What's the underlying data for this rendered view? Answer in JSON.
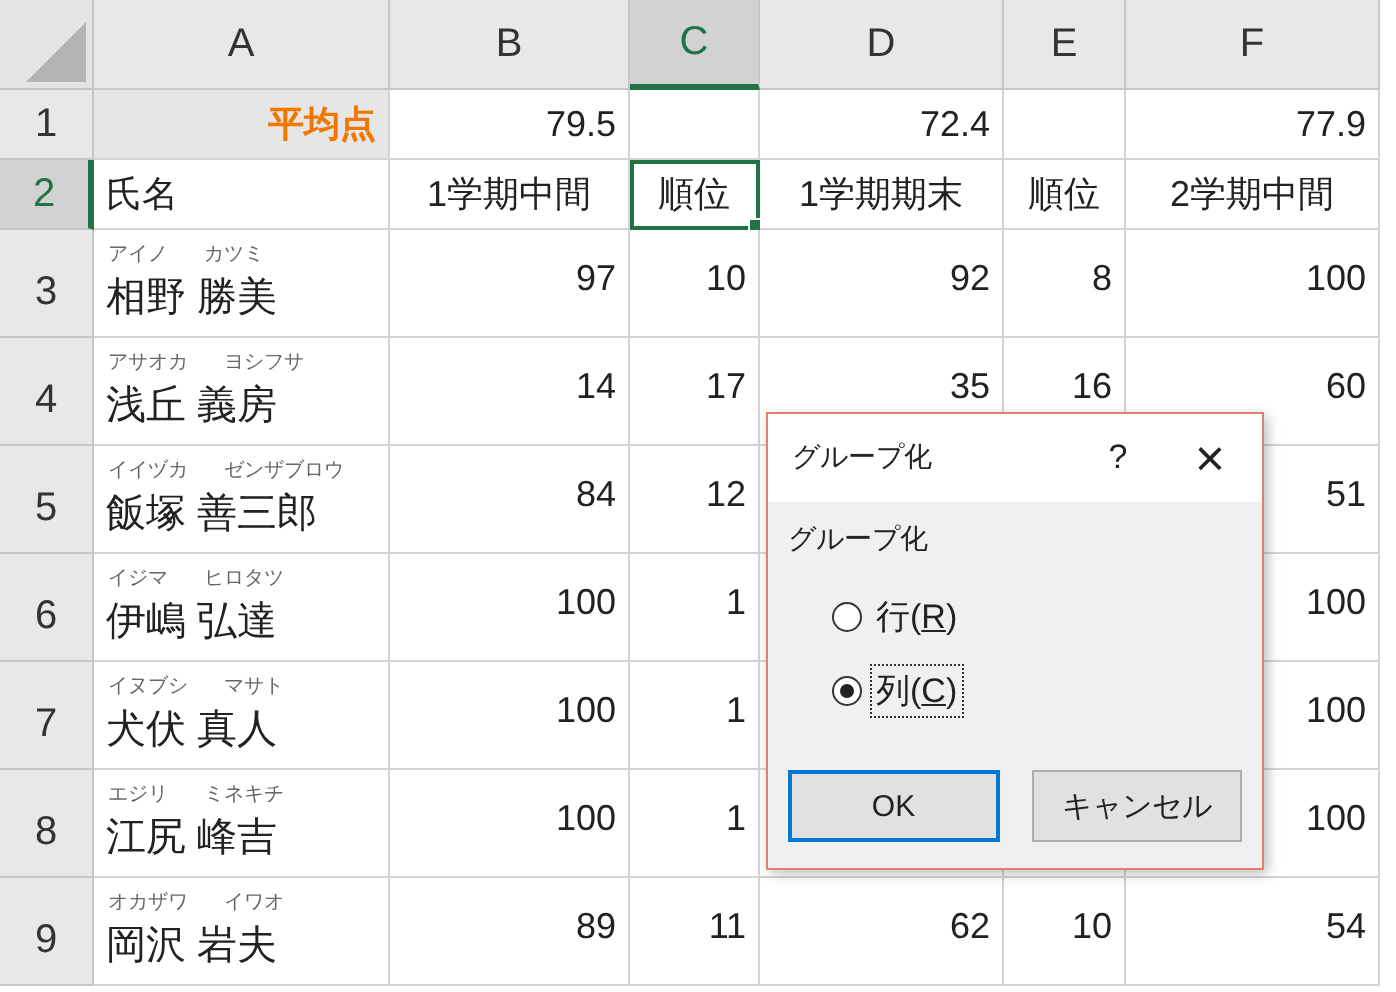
{
  "sheet": {
    "columns": [
      {
        "label": "A",
        "selected": false
      },
      {
        "label": "B",
        "selected": false
      },
      {
        "label": "C",
        "selected": true
      },
      {
        "label": "D",
        "selected": false
      },
      {
        "label": "E",
        "selected": false
      },
      {
        "label": "F",
        "selected": false
      }
    ],
    "rows": [
      {
        "header": "1",
        "selected": false,
        "kind": "summary",
        "label": "平均点",
        "cells": [
          "79.5",
          "",
          "72.4",
          "",
          "77.9"
        ]
      },
      {
        "header": "2",
        "selected": true,
        "kind": "heading",
        "label": "氏名",
        "cells": [
          "1学期中間",
          "順位",
          "1学期期末",
          "順位",
          "2学期中間"
        ]
      },
      {
        "header": "3",
        "selected": false,
        "kind": "student",
        "furigana": [
          "アイノ",
          "カツミ"
        ],
        "label": "相野 勝美",
        "cells": [
          "97",
          "10",
          "92",
          "8",
          "100"
        ]
      },
      {
        "header": "4",
        "selected": false,
        "kind": "student",
        "furigana": [
          "アサオカ",
          "ヨシフサ"
        ],
        "label": "浅丘 義房",
        "cells": [
          "14",
          "17",
          "35",
          "16",
          "60"
        ]
      },
      {
        "header": "5",
        "selected": false,
        "kind": "student",
        "furigana": [
          "イイヅカ",
          "ゼンザブロウ"
        ],
        "label": "飯塚 善三郎",
        "cells": [
          "84",
          "12",
          null,
          null,
          "51"
        ]
      },
      {
        "header": "6",
        "selected": false,
        "kind": "student",
        "furigana": [
          "イジマ",
          "ヒロタツ"
        ],
        "label": "伊嶋 弘達",
        "cells": [
          "100",
          "1",
          null,
          null,
          "100"
        ]
      },
      {
        "header": "7",
        "selected": false,
        "kind": "student",
        "furigana": [
          "イヌブシ",
          "マサト"
        ],
        "label": "犬伏 真人",
        "cells": [
          "100",
          "1",
          null,
          null,
          "100"
        ]
      },
      {
        "header": "8",
        "selected": false,
        "kind": "student",
        "furigana": [
          "エジリ",
          "ミネキチ"
        ],
        "label": "江尻 峰吉",
        "cells": [
          "100",
          "1",
          null,
          null,
          "100"
        ]
      },
      {
        "header": "9",
        "selected": false,
        "kind": "student",
        "furigana": [
          "オカザワ",
          "イワオ"
        ],
        "label": "岡沢 岩夫",
        "cells": [
          "89",
          "11",
          "62",
          "10",
          "54"
        ]
      }
    ]
  },
  "dialog": {
    "title": "グループ化",
    "help": "?",
    "close": "×",
    "group_label": "グループ化",
    "options": [
      {
        "prefix": "行(",
        "accel": "R",
        "suffix": ")",
        "selected": false
      },
      {
        "prefix": "列(",
        "accel": "C",
        "suffix": ")",
        "selected": true
      }
    ],
    "buttons": [
      {
        "label": "OK",
        "default": true
      },
      {
        "label": "キャンセル",
        "default": false
      }
    ]
  }
}
